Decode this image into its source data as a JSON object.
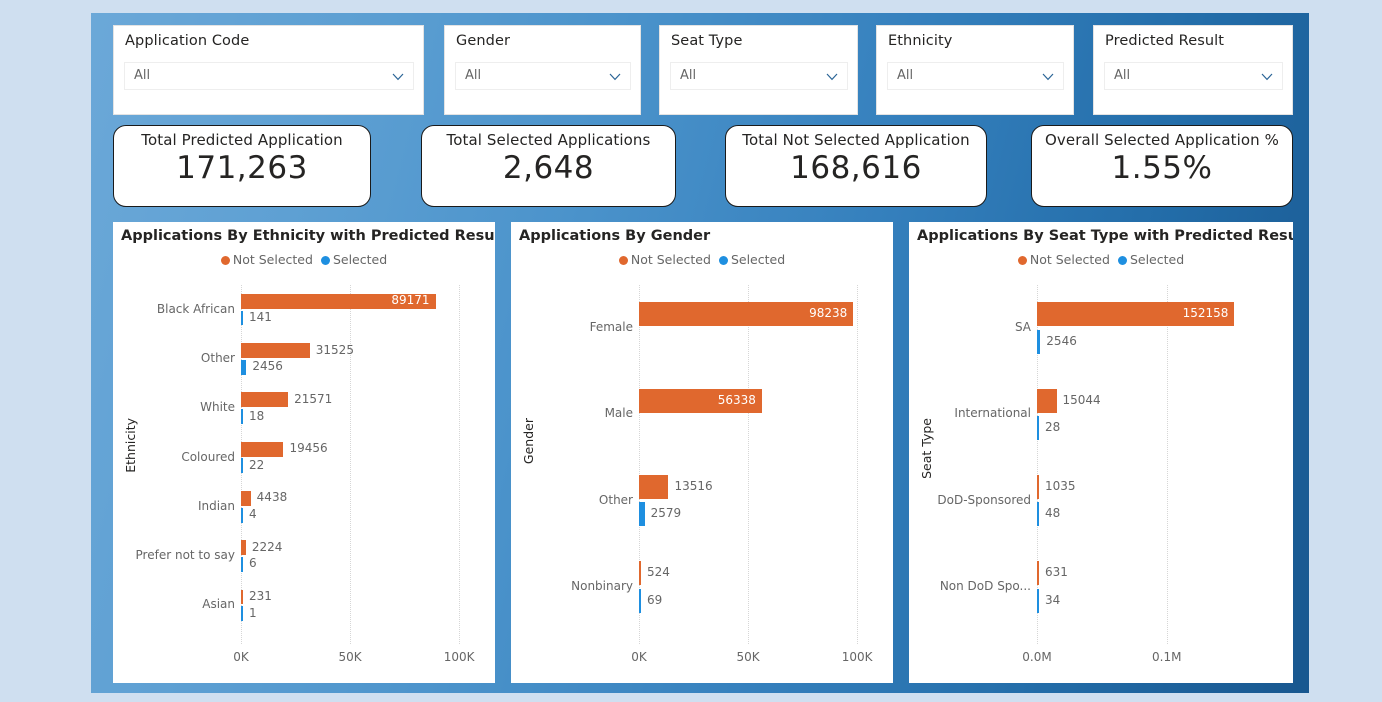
{
  "theme": {
    "page_bg": "#cfdff0",
    "canvas_grad_from": "#6ba8d8",
    "canvas_grad_to": "#18578f",
    "not_selected_color": "#e0682e",
    "selected_color": "#1e8fe0",
    "panel_bg": "#ffffff",
    "text_color": "#252423",
    "muted_text": "#666666"
  },
  "slicers": [
    {
      "title": "Application Code",
      "value": "All",
      "icon": "chevron-down-icon"
    },
    {
      "title": "Gender",
      "value": "All",
      "icon": "chevron-down-icon"
    },
    {
      "title": "Seat Type",
      "value": "All",
      "icon": "chevron-down-icon"
    },
    {
      "title": "Ethnicity",
      "value": "All",
      "icon": "chevron-down-icon"
    },
    {
      "title": "Predicted Result",
      "value": "All",
      "icon": "chevron-down-icon"
    }
  ],
  "kpis": [
    {
      "label": "Total Predicted Application",
      "value": "171,263"
    },
    {
      "label": "Total Selected Applications",
      "value": "2,648"
    },
    {
      "label": "Total Not Selected Application",
      "value": "168,616"
    },
    {
      "label": "Overall Selected Application %",
      "value": "1.55%"
    }
  ],
  "legend": {
    "not_selected": "Not Selected",
    "selected": "Selected"
  },
  "chart_data": [
    {
      "type": "bar",
      "orientation": "horizontal",
      "title": "Applications By Ethnicity with Predicted Result",
      "ylabel": "Ethnicity",
      "xlabel": "",
      "categories": [
        "Black African",
        "Other",
        "White",
        "Coloured",
        "Indian",
        "Prefer not to say",
        "Asian"
      ],
      "series": [
        {
          "name": "Not Selected",
          "color": "#e0682e",
          "values": [
            89171,
            31525,
            21571,
            19456,
            4438,
            2224,
            231
          ]
        },
        {
          "name": "Selected",
          "color": "#1e8fe0",
          "values": [
            141,
            2456,
            18,
            22,
            4,
            6,
            1
          ]
        }
      ],
      "xticks": [
        "0K",
        "50K",
        "100K"
      ],
      "xtick_values": [
        0,
        50000,
        100000
      ],
      "xlim": [
        0,
        110000
      ],
      "grid": true,
      "legend_position": "top"
    },
    {
      "type": "bar",
      "orientation": "horizontal",
      "title": "Applications By Gender",
      "ylabel": "Gender",
      "xlabel": "",
      "categories": [
        "Female",
        "Male",
        "Other",
        "Nonbinary"
      ],
      "series": [
        {
          "name": "Not Selected",
          "color": "#e0682e",
          "values": [
            98238,
            56338,
            13516,
            524
          ]
        },
        {
          "name": "Selected",
          "color": "#1e8fe0",
          "values": [
            0,
            0,
            2579,
            69
          ]
        }
      ],
      "xticks": [
        "0K",
        "50K",
        "100K"
      ],
      "xtick_values": [
        0,
        50000,
        100000
      ],
      "xlim": [
        0,
        110000
      ],
      "grid": true,
      "legend_position": "top"
    },
    {
      "type": "bar",
      "orientation": "horizontal",
      "title": "Applications By Seat Type with Predicted Result",
      "ylabel": "Seat Type",
      "xlabel": "",
      "categories": [
        "SA",
        "International",
        "DoD-Sponsored",
        "Non DoD Spo..."
      ],
      "series": [
        {
          "name": "Not Selected",
          "color": "#e0682e",
          "values": [
            152158,
            15044,
            1035,
            631
          ]
        },
        {
          "name": "Selected",
          "color": "#1e8fe0",
          "values": [
            2546,
            28,
            48,
            34
          ]
        }
      ],
      "xticks": [
        "0.0M",
        "0.1M"
      ],
      "xtick_values": [
        0,
        100000
      ],
      "xlim": [
        0,
        185000
      ],
      "grid": true,
      "legend_position": "top"
    }
  ]
}
